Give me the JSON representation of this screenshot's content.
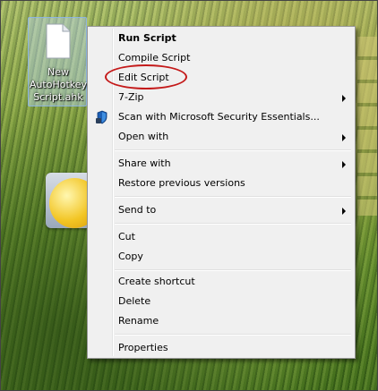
{
  "desktop": {
    "file_icon": {
      "label": "New\nAutoHotkey\nScript.ahk",
      "icon": "file-icon"
    },
    "gadget_icon": {
      "icon": "gadget-icon"
    }
  },
  "context_menu": {
    "items": [
      {
        "label": "Run Script",
        "bold": true,
        "submenu": false
      },
      {
        "label": "Compile Script",
        "submenu": false
      },
      {
        "label": "Edit Script",
        "submenu": false,
        "annotated": true
      },
      {
        "label": "7-Zip",
        "submenu": true
      },
      {
        "label": "Scan with Microsoft Security Essentials...",
        "icon": "security-shield-icon",
        "submenu": false
      },
      {
        "label": "Open with",
        "submenu": true
      },
      {
        "label": "Share with",
        "submenu": true
      },
      {
        "label": "Restore previous versions",
        "submenu": false
      },
      {
        "label": "Send to",
        "submenu": true
      },
      {
        "label": "Cut",
        "submenu": false
      },
      {
        "label": "Copy",
        "submenu": false
      },
      {
        "label": "Create shortcut",
        "submenu": false
      },
      {
        "label": "Delete",
        "submenu": false
      },
      {
        "label": "Rename",
        "submenu": false
      },
      {
        "label": "Properties",
        "submenu": false
      }
    ]
  },
  "colors": {
    "menu_background": "#f0f0f0",
    "annotation_ellipse": "#c41a1a"
  }
}
